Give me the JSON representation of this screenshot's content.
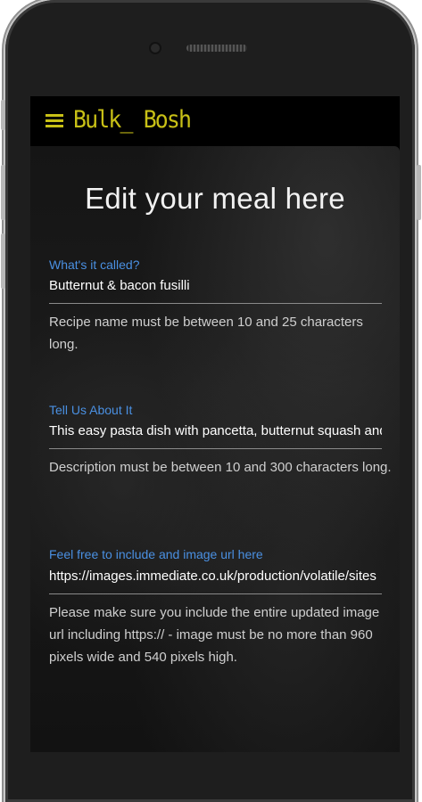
{
  "navbar": {
    "brand": "Bulk_ Bosh",
    "menu_icon": "hamburger-menu-icon",
    "accent_color": "#c8c016"
  },
  "form": {
    "title": "Edit your meal here",
    "label_color": "#4a90e2",
    "fields": [
      {
        "label": "What's it called?",
        "value": "Butternut & bacon fusilli",
        "helper": "Recipe name must be between 10 and 25 characters long."
      },
      {
        "label": "Tell Us About It",
        "value": "This easy pasta dish with pancetta, butternut squash and",
        "helper": "Description must be between 10 and 300 characters long."
      },
      {
        "label": "Feel free to include and image url here",
        "value": "https://images.immediate.co.uk/production/volatile/sites",
        "helper": "Please make sure you include the entire updated image url including https:// - image must be no more than 960 pixels wide and 540 pixels high."
      }
    ]
  }
}
